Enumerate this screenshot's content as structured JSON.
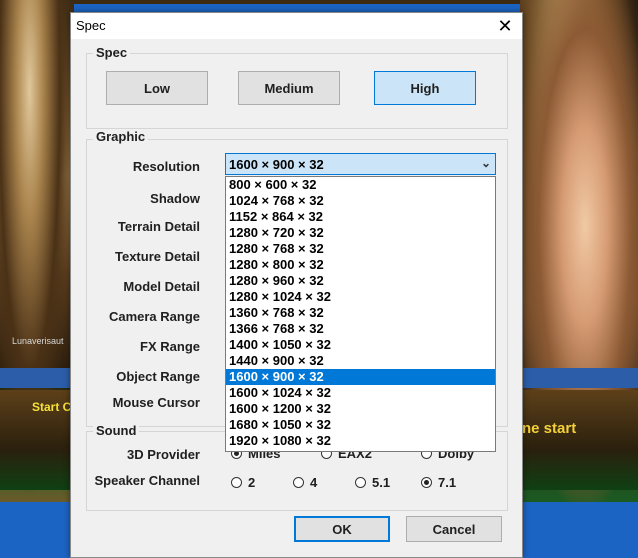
{
  "background": {
    "start_left": "Start C",
    "start_right": "ne start",
    "luna_label": "Lunaverisaut"
  },
  "dialog": {
    "title": "Spec",
    "close_glyph": "✕"
  },
  "spec": {
    "legend": "Spec",
    "buttons": [
      {
        "label": "Low",
        "active": false
      },
      {
        "label": "Medium",
        "active": false
      },
      {
        "label": "High",
        "active": true
      }
    ]
  },
  "graphic": {
    "legend": "Graphic",
    "labels": {
      "resolution": "Resolution",
      "shadow": "Shadow",
      "terrain_detail": "Terrain Detail",
      "texture_detail": "Texture Detail",
      "model_detail": "Model Detail",
      "camera_range": "Camera Range",
      "fx_range": "FX Range",
      "object_range": "Object Range",
      "mouse_cursor": "Mouse Cursor"
    },
    "resolution": {
      "selected": "1600 × 900 × 32",
      "options": [
        "800 × 600 × 32",
        "1024 × 768 × 32",
        "1152 × 864 × 32",
        "1280 × 720 × 32",
        "1280 × 768 × 32",
        "1280 × 800 × 32",
        "1280 × 960 × 32",
        "1280 × 1024 × 32",
        "1360 × 768 × 32",
        "1366 × 768 × 32",
        "1400 × 1050 × 32",
        "1440 × 900 × 32",
        "1600 × 900 × 32",
        "1600 × 1024 × 32",
        "1600 × 1200 × 32",
        "1680 × 1050 × 32",
        "1920 × 1080 × 32"
      ]
    }
  },
  "sound": {
    "legend": "Sound",
    "provider_label": "3D Provider",
    "providers": [
      {
        "label": "Miles",
        "checked": true
      },
      {
        "label": "EAX2",
        "checked": false
      },
      {
        "label": "Dolby",
        "checked": false
      }
    ],
    "channel_label": "Speaker Channel",
    "channels": [
      {
        "label": "2",
        "checked": false
      },
      {
        "label": "4",
        "checked": false
      },
      {
        "label": "5.1",
        "checked": false
      },
      {
        "label": "7.1",
        "checked": true
      }
    ]
  },
  "footer": {
    "ok_label": "OK",
    "cancel_label": "Cancel"
  },
  "colors": {
    "accent": "#0078d7",
    "selected_bg": "#cce4f7",
    "desktop": "#1c64c4"
  }
}
